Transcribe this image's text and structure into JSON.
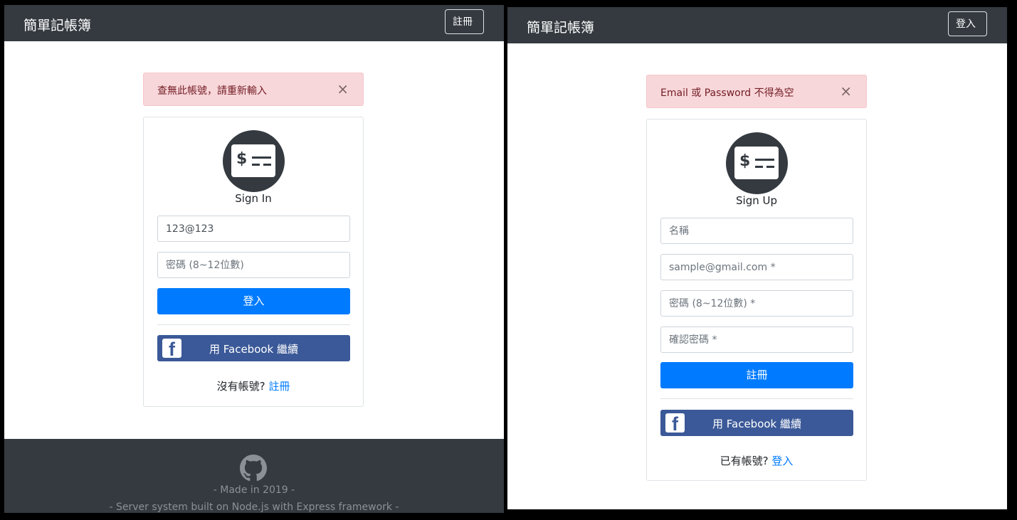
{
  "left": {
    "navbar": {
      "brand": "簡單記帳簿",
      "action": "註冊"
    },
    "alert": {
      "message": "查無此帳號，請重新輸入",
      "close": "×"
    },
    "card": {
      "title": "Sign In",
      "email": {
        "value": "123@123",
        "placeholder": ""
      },
      "password": {
        "placeholder": "密碼 (8~12位數)"
      },
      "submit_label": "登入",
      "facebook_label": "用 Facebook 繼續",
      "prompt": "沒有帳號?",
      "link": "註冊"
    },
    "footer": {
      "line1": "- Made in 2019 -",
      "line2": "- Server system built on Node.js with Express framework -"
    }
  },
  "right": {
    "navbar": {
      "brand": "簡單記帳簿",
      "action": "登入"
    },
    "alert": {
      "message": "Email 或 Password 不得為空",
      "close": "×"
    },
    "card": {
      "title": "Sign Up",
      "name": {
        "placeholder": "名稱"
      },
      "email": {
        "placeholder": "sample@gmail.com *"
      },
      "password": {
        "placeholder": "密碼 (8~12位數) *"
      },
      "confirm": {
        "placeholder": "確認密碼 *"
      },
      "submit_label": "註冊",
      "facebook_label": "用 Facebook 繼續",
      "prompt": "已有帳號?",
      "link": "登入"
    }
  },
  "colors": {
    "navbar": "#343a40",
    "primary": "#007bff",
    "facebook": "#3b5998",
    "alert_bg": "#f8d7da",
    "alert_text": "#721c24"
  },
  "icons": {
    "logo": "dollar-receipt-icon",
    "facebook": "facebook-icon",
    "github": "github-icon",
    "close": "close-icon"
  }
}
